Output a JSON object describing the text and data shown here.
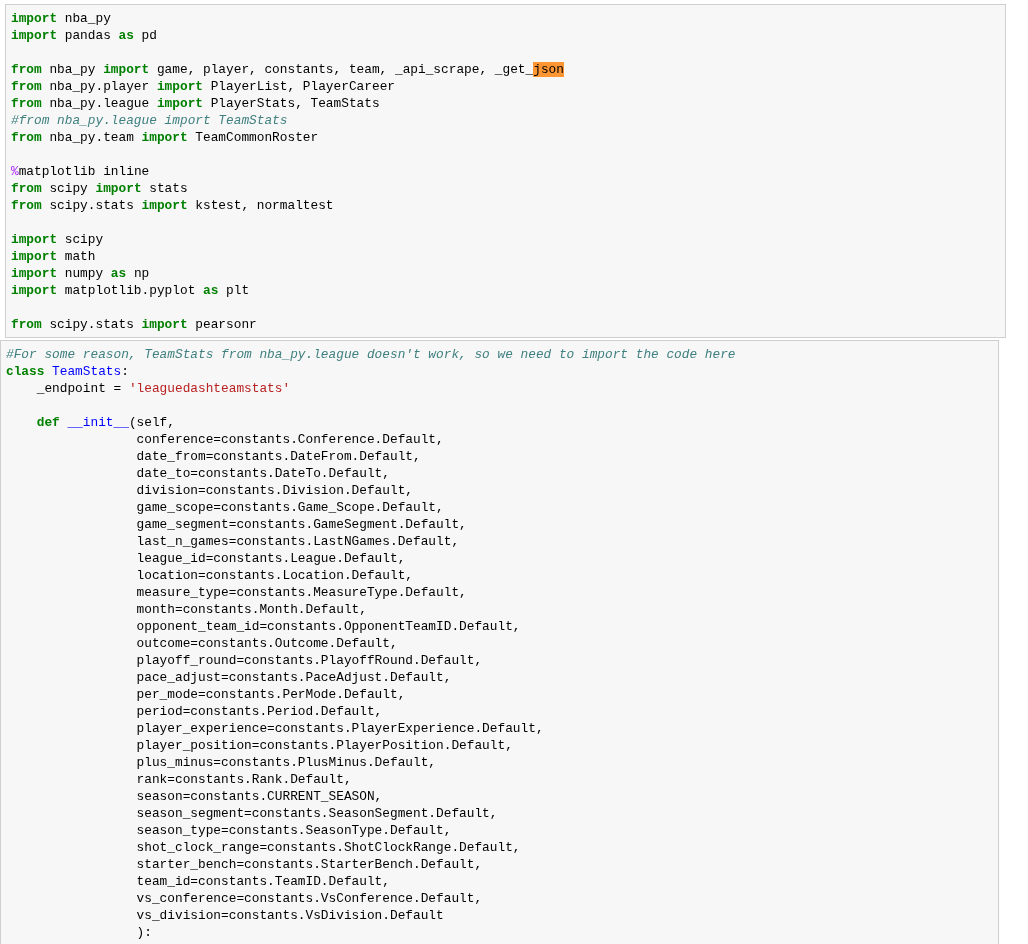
{
  "cells": [
    {
      "blocks": [
        [
          [
            {
              "kind": "keyword",
              "text": "import"
            },
            {
              "kind": "plain",
              "text": " nba_py"
            }
          ],
          [
            {
              "kind": "keyword",
              "text": "import"
            },
            {
              "kind": "plain",
              "text": " pandas "
            },
            {
              "kind": "keyword",
              "text": "as"
            },
            {
              "kind": "plain",
              "text": " pd"
            }
          ]
        ],
        [
          [
            {
              "kind": "keyword",
              "text": "from"
            },
            {
              "kind": "plain",
              "text": " nba_py "
            },
            {
              "kind": "keyword",
              "text": "import"
            },
            {
              "kind": "plain",
              "text": " game, player, constants, team, _api_scrape, _get_"
            },
            {
              "kind": "highlight",
              "text": "json"
            }
          ],
          [
            {
              "kind": "keyword",
              "text": "from"
            },
            {
              "kind": "plain",
              "text": " nba_py.player "
            },
            {
              "kind": "keyword",
              "text": "import"
            },
            {
              "kind": "plain",
              "text": " PlayerList, PlayerCareer"
            }
          ],
          [
            {
              "kind": "keyword",
              "text": "from"
            },
            {
              "kind": "plain",
              "text": " nba_py.league "
            },
            {
              "kind": "keyword",
              "text": "import"
            },
            {
              "kind": "plain",
              "text": " PlayerStats, TeamStats"
            }
          ],
          [
            {
              "kind": "comment",
              "text": "#from nba_py.league import TeamStats"
            }
          ],
          [
            {
              "kind": "keyword",
              "text": "from"
            },
            {
              "kind": "plain",
              "text": " nba_py.team "
            },
            {
              "kind": "keyword",
              "text": "import"
            },
            {
              "kind": "plain",
              "text": " TeamCommonRoster"
            }
          ]
        ],
        [
          [
            {
              "kind": "magic",
              "text": "%"
            },
            {
              "kind": "plain",
              "text": "matplotlib inline"
            }
          ],
          [
            {
              "kind": "keyword",
              "text": "from"
            },
            {
              "kind": "plain",
              "text": " scipy "
            },
            {
              "kind": "keyword",
              "text": "import"
            },
            {
              "kind": "plain",
              "text": " stats"
            }
          ],
          [
            {
              "kind": "keyword",
              "text": "from"
            },
            {
              "kind": "plain",
              "text": " scipy.stats "
            },
            {
              "kind": "keyword",
              "text": "import"
            },
            {
              "kind": "plain",
              "text": " kstest, normaltest"
            }
          ]
        ],
        [
          [
            {
              "kind": "keyword",
              "text": "import"
            },
            {
              "kind": "plain",
              "text": " scipy"
            }
          ],
          [
            {
              "kind": "keyword",
              "text": "import"
            },
            {
              "kind": "plain",
              "text": " math"
            }
          ],
          [
            {
              "kind": "keyword",
              "text": "import"
            },
            {
              "kind": "plain",
              "text": " numpy "
            },
            {
              "kind": "keyword",
              "text": "as"
            },
            {
              "kind": "plain",
              "text": " np"
            }
          ],
          [
            {
              "kind": "keyword",
              "text": "import"
            },
            {
              "kind": "plain",
              "text": " matplotlib.pyplot "
            },
            {
              "kind": "keyword",
              "text": "as"
            },
            {
              "kind": "plain",
              "text": " plt"
            }
          ]
        ],
        [
          [
            {
              "kind": "keyword",
              "text": "from"
            },
            {
              "kind": "plain",
              "text": " scipy.stats "
            },
            {
              "kind": "keyword",
              "text": "import"
            },
            {
              "kind": "plain",
              "text": " pearsonr"
            }
          ]
        ]
      ]
    },
    {
      "blocks": [
        [
          [
            {
              "kind": "comment",
              "text": "#For some reason, TeamStats from nba_py.league doesn't work, so we need to import the code here"
            }
          ],
          [
            {
              "kind": "keyword",
              "text": "class "
            },
            {
              "kind": "name",
              "text": "TeamStats"
            },
            {
              "kind": "plain",
              "text": ":"
            }
          ],
          [
            {
              "kind": "plain",
              "text": "    _endpoint = "
            },
            {
              "kind": "string",
              "text": "'leaguedashteamstats'"
            }
          ]
        ],
        [
          [
            {
              "kind": "keyword",
              "text": "    def "
            },
            {
              "kind": "name",
              "text": "__init__"
            },
            {
              "kind": "plain",
              "text": "(self,"
            }
          ],
          [
            {
              "kind": "plain",
              "text": "                 conference=constants.Conference.Default,"
            }
          ],
          [
            {
              "kind": "plain",
              "text": "                 date_from=constants.DateFrom.Default,"
            }
          ],
          [
            {
              "kind": "plain",
              "text": "                 date_to=constants.DateTo.Default,"
            }
          ],
          [
            {
              "kind": "plain",
              "text": "                 division=constants.Division.Default,"
            }
          ],
          [
            {
              "kind": "plain",
              "text": "                 game_scope=constants.Game_Scope.Default,"
            }
          ],
          [
            {
              "kind": "plain",
              "text": "                 game_segment=constants.GameSegment.Default,"
            }
          ],
          [
            {
              "kind": "plain",
              "text": "                 last_n_games=constants.LastNGames.Default,"
            }
          ],
          [
            {
              "kind": "plain",
              "text": "                 league_id=constants.League.Default,"
            }
          ],
          [
            {
              "kind": "plain",
              "text": "                 location=constants.Location.Default,"
            }
          ],
          [
            {
              "kind": "plain",
              "text": "                 measure_type=constants.MeasureType.Default,"
            }
          ],
          [
            {
              "kind": "plain",
              "text": "                 month=constants.Month.Default,"
            }
          ],
          [
            {
              "kind": "plain",
              "text": "                 opponent_team_id=constants.OpponentTeamID.Default,"
            }
          ],
          [
            {
              "kind": "plain",
              "text": "                 outcome=constants.Outcome.Default,"
            }
          ],
          [
            {
              "kind": "plain",
              "text": "                 playoff_round=constants.PlayoffRound.Default,"
            }
          ],
          [
            {
              "kind": "plain",
              "text": "                 pace_adjust=constants.PaceAdjust.Default,"
            }
          ],
          [
            {
              "kind": "plain",
              "text": "                 per_mode=constants.PerMode.Default,"
            }
          ],
          [
            {
              "kind": "plain",
              "text": "                 period=constants.Period.Default,"
            }
          ],
          [
            {
              "kind": "plain",
              "text": "                 player_experience=constants.PlayerExperience.Default,"
            }
          ],
          [
            {
              "kind": "plain",
              "text": "                 player_position=constants.PlayerPosition.Default,"
            }
          ],
          [
            {
              "kind": "plain",
              "text": "                 plus_minus=constants.PlusMinus.Default,"
            }
          ],
          [
            {
              "kind": "plain",
              "text": "                 rank=constants.Rank.Default,"
            }
          ],
          [
            {
              "kind": "plain",
              "text": "                 season=constants.CURRENT_SEASON,"
            }
          ],
          [
            {
              "kind": "plain",
              "text": "                 season_segment=constants.SeasonSegment.Default,"
            }
          ],
          [
            {
              "kind": "plain",
              "text": "                 season_type=constants.SeasonType.Default,"
            }
          ],
          [
            {
              "kind": "plain",
              "text": "                 shot_clock_range=constants.ShotClockRange.Default,"
            }
          ],
          [
            {
              "kind": "plain",
              "text": "                 starter_bench=constants.StarterBench.Default,"
            }
          ],
          [
            {
              "kind": "plain",
              "text": "                 team_id=constants.TeamID.Default,"
            }
          ],
          [
            {
              "kind": "plain",
              "text": "                 vs_conference=constants.VsConference.Default,"
            }
          ],
          [
            {
              "kind": "plain",
              "text": "                 vs_division=constants.VsDivision.Default"
            }
          ],
          [
            {
              "kind": "plain",
              "text": "                 ):"
            }
          ]
        ]
      ]
    }
  ]
}
